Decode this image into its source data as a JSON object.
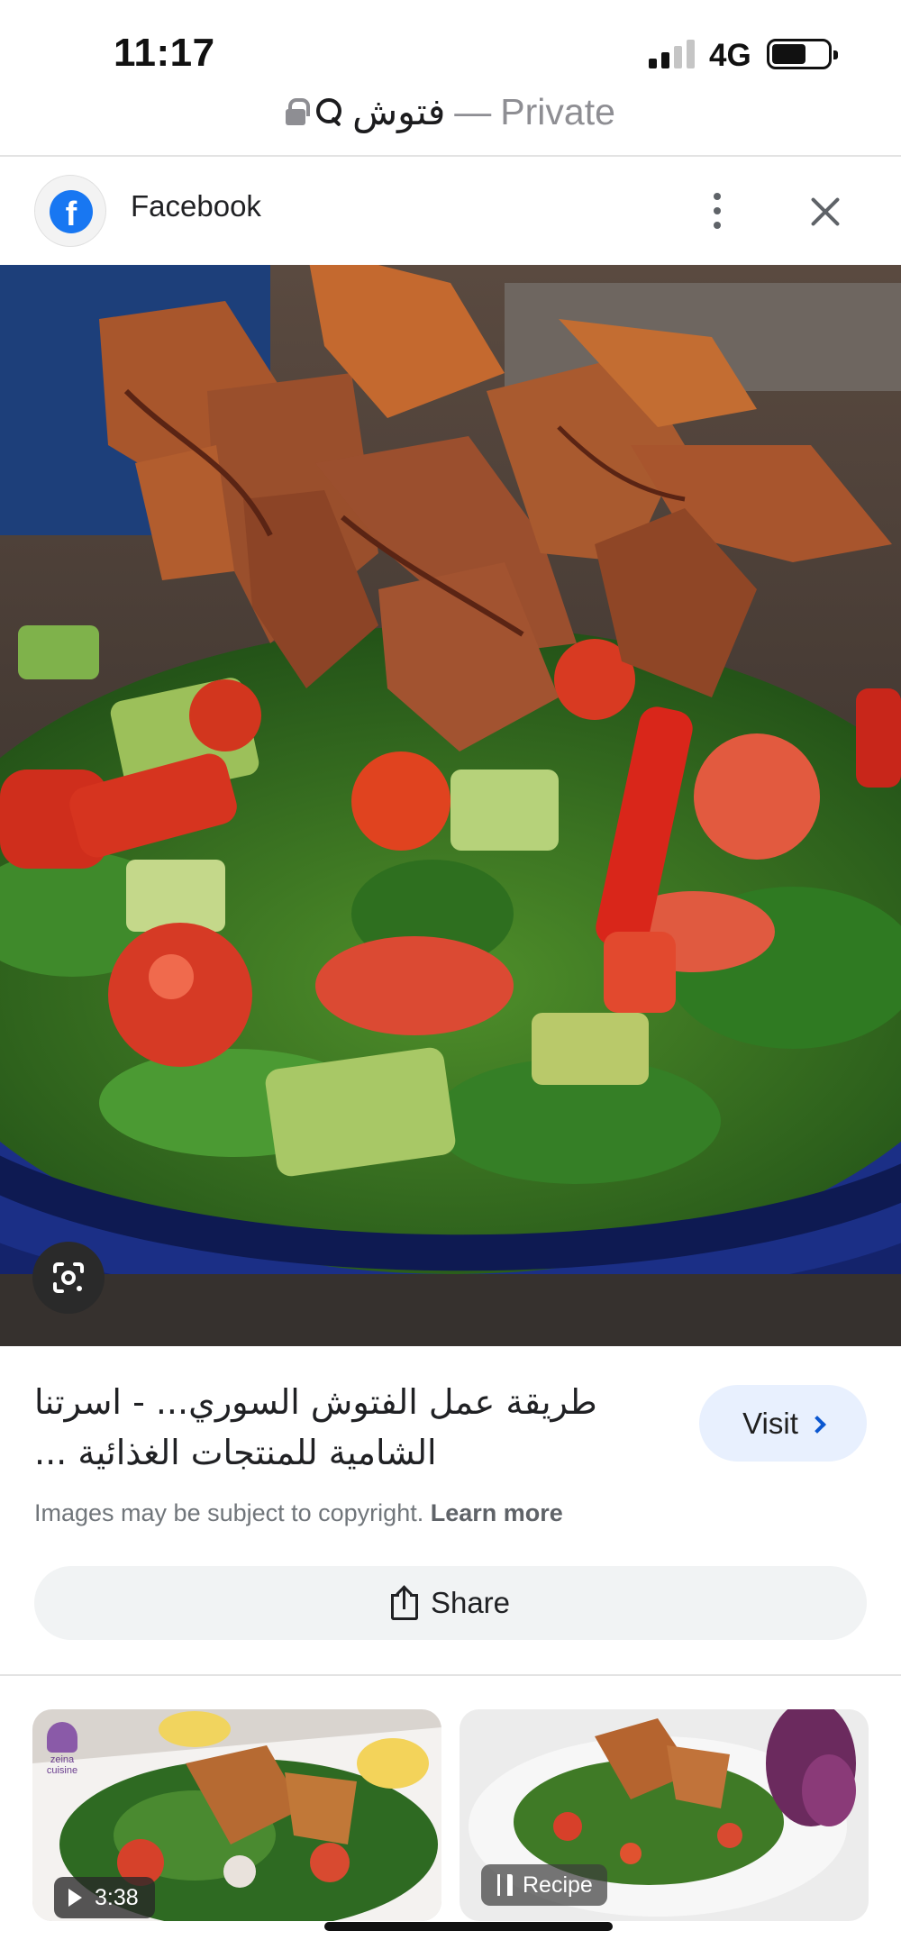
{
  "status_bar": {
    "time": "11:17",
    "network": "4G"
  },
  "url_bar": {
    "query": "فتوش",
    "separator": "—",
    "mode": "Private"
  },
  "source": {
    "name": "Facebook",
    "logo_letter": "f",
    "logo_color": "#1877f2"
  },
  "result": {
    "title": "طريقة عمل الفتوش السوري... - اسرتنا الشامية للمنتجات الغذائية ...",
    "visit_label": "Visit",
    "copyright_text": "Images may be subject to copyright.",
    "learn_more_label": "Learn more",
    "share_label": "Share"
  },
  "related": [
    {
      "badge": "3:38",
      "badge_type": "video",
      "watermark": "zeina cuisine"
    },
    {
      "badge": "Recipe",
      "badge_type": "recipe"
    }
  ],
  "colors": {
    "accent_blue": "#0b57d0",
    "visit_bg": "#e8f0fe",
    "share_bg": "#f1f3f4"
  }
}
